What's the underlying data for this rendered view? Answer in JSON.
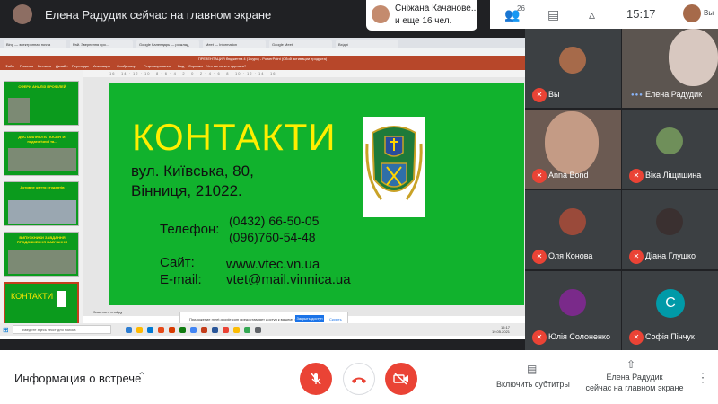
{
  "topbar": {
    "presenter_text": "Елена Радудик сейчас на главном экране",
    "notification_line1": "Сніжана Качанове...",
    "notification_line2": "и еще 16 чел.",
    "people_count": "26",
    "time": "15:17",
    "self_label": "Вы"
  },
  "shared_screen": {
    "browser_tabs": [
      "Bing — электронная почта",
      "Рай. Звернення про...",
      "Google Календарь — розклад",
      "Meet — Information",
      "Google Meet",
      "Вхідні"
    ],
    "ppt_title": "ПРЕЗЕНТАЦИЯ бюджетна 4 (1 курс) - PowerPoint (Сбой активации продукта)",
    "ribbon_menu": [
      "Файл",
      "Главная",
      "Вставка",
      "Дизайн",
      "Переходы",
      "Анимация",
      "Слайд-шоу",
      "Рецензирование",
      "Вид",
      "Справка",
      "Что вы хотите сделать?"
    ],
    "ruler": "16 · 14 · 12 · 10 · 8 · 6 · 4 · 2 · 0 · 2 · 4 · 6 · 8 · 10 · 12 · 14 · 16",
    "thumbnails": [
      {
        "text": "СФЕРИ АНАЛІЗ ПРОФІЛЕЙ"
      },
      {
        "text": "ДОСТАВЛЯЮТЬ ПОСЛУГИ: педагогічної та..."
      },
      {
        "text": "Активне життя студентів"
      },
      {
        "text": "ВИПУСКНИКИ ЗАВДАННЯ ПРОДОВЖЕННЯ НАВЧАННЯ"
      },
      {
        "text": "КОНТАКТИ"
      }
    ],
    "slide": {
      "title": "КОНТАКТИ",
      "address_line1": "вул. Київська, 80,",
      "address_line2": "Вінниця, 21022.",
      "phone_label": "Телефон:",
      "phone1": "(0432) 66-50-05",
      "phone2": "(096)760-54-48",
      "site_label": "Сайт:",
      "site_value": "www.vtec.vn.ua",
      "email_label": "E-mail:",
      "email_value": "vtet@mail.vinnica.ua"
    },
    "status_text": "Заметки к слайду",
    "toast_text": "Приложение meet.google.com предоставляет доступ к вашему экрану.",
    "toast_button": "Закрыть доступ",
    "toast_close": "Скрыть",
    "taskbar_search": "Введите здесь текст для поиска",
    "taskbar_time": "15:17",
    "taskbar_date": "19.05.2021"
  },
  "participants": [
    {
      "name": "Вы",
      "muted": true
    },
    {
      "name": "Елена Радудик",
      "muted": false
    },
    {
      "name": "Anna Bond",
      "muted": true
    },
    {
      "name": "Віка Ліщишина",
      "muted": true
    },
    {
      "name": "Оля Конова",
      "muted": true
    },
    {
      "name": "Діана Глушко",
      "muted": true
    },
    {
      "name": "Юлія Солоненко",
      "muted": true
    },
    {
      "name": "Софія Пінчук",
      "muted": true,
      "initial": "C"
    }
  ],
  "bottombar": {
    "meeting_info": "Информация о встрече",
    "captions_label": "Включить субтитры",
    "presenter_line1": "Елена Радудик",
    "presenter_line2": "сейчас на главном экране"
  },
  "colors": {
    "slide_green": "#11b22d",
    "slide_title_yellow": "#ffee00",
    "mute_red": "#ea4335",
    "ppt_ribbon": "#b7472a"
  }
}
